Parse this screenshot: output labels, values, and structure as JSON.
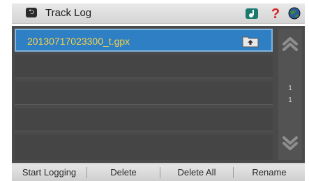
{
  "header": {
    "title": "Track Log",
    "icons": [
      "back-icon",
      "music-note-icon",
      "help-icon",
      "globe-icon"
    ]
  },
  "list": {
    "items": [
      {
        "label": "20130717023300_t.gpx",
        "selected": true,
        "icon": "folder-upload-icon"
      },
      {
        "label": ""
      },
      {
        "label": ""
      },
      {
        "label": ""
      },
      {
        "label": ""
      }
    ]
  },
  "pager": {
    "current": "1",
    "total": "1"
  },
  "toolbar": {
    "start_logging": "Start Logging",
    "delete": "Delete",
    "delete_all": "Delete All",
    "rename": "Rename"
  },
  "colors": {
    "selected_row": "#2f7fc4",
    "file_text": "#f2d24a",
    "list_bg": "#4a4a4a",
    "help_icon": "#d62020"
  }
}
